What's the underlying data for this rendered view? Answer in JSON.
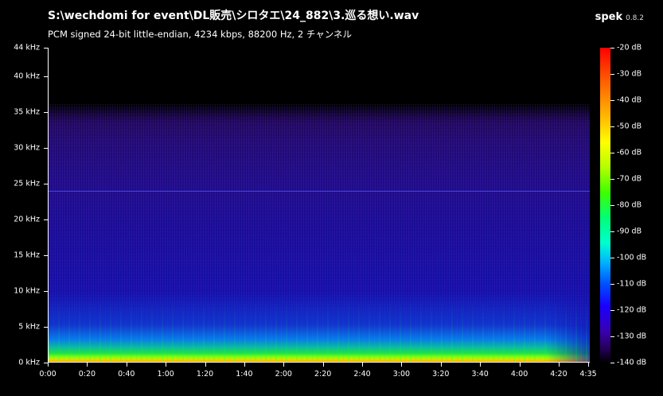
{
  "window": {
    "title": "S:\\wechdomi for event\\DL販売\\シロタエ\\24_882\\3.巡る想い.wav",
    "subtitle": "PCM signed 24-bit little-endian, 4234 kbps, 88200 Hz, 2 チャンネル"
  },
  "brand": {
    "name": "spek",
    "version": "0.8.2"
  },
  "colors": {
    "background": "#000000",
    "axis": "#ffffff",
    "line_24khz": "#3a55ff"
  },
  "spectrogram": {
    "frequency_axis": [
      "0 kHz",
      "5 kHz",
      "10 kHz",
      "15 kHz",
      "20 kHz",
      "25 kHz",
      "30 kHz",
      "35 kHz",
      "40 kHz",
      "44 kHz"
    ],
    "time_axis": [
      "0:00",
      "0:20",
      "0:40",
      "1:00",
      "1:20",
      "1:40",
      "2:00",
      "2:20",
      "2:40",
      "3:00",
      "3:20",
      "3:40",
      "4:00",
      "4:20",
      "4:35"
    ],
    "max_frequency_khz": 44,
    "duration_seconds": 275,
    "horizontal_line_khz": 24
  },
  "colorbar": {
    "labels": [
      "-20 dB",
      "-30 dB",
      "-40 dB",
      "-50 dB",
      "-60 dB",
      "-70 dB",
      "-80 dB",
      "-90 dB",
      "-100 dB",
      "-110 dB",
      "-120 dB",
      "-130 dB",
      "-140 dB"
    ]
  }
}
